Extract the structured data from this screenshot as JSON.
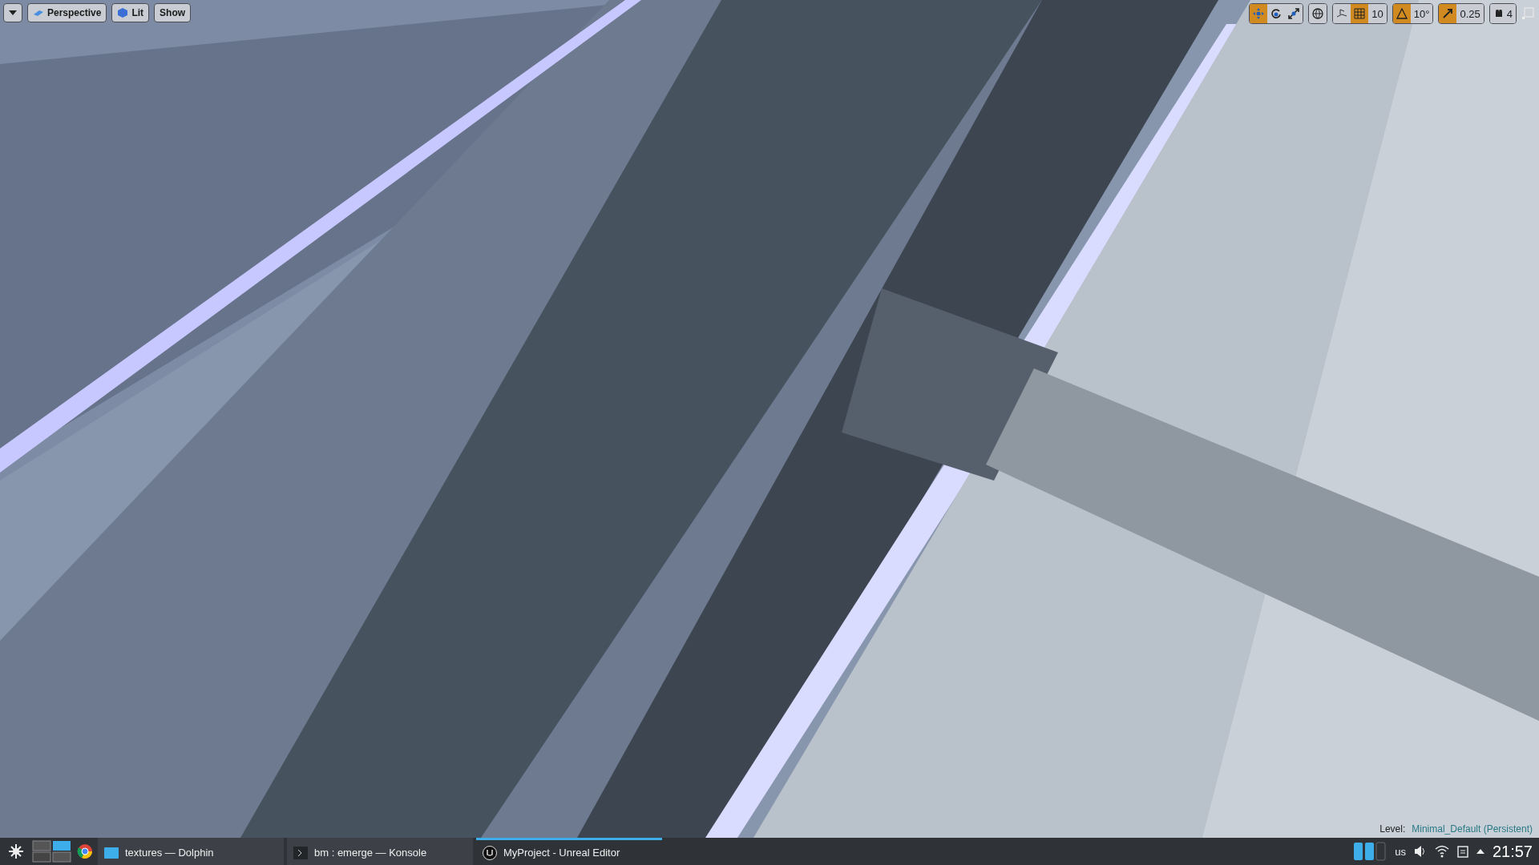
{
  "viewport_toolbar": {
    "left": [
      {
        "kind": "menu"
      },
      {
        "kind": "button",
        "label": "Perspective"
      },
      {
        "kind": "button",
        "label": "Lit"
      },
      {
        "kind": "button",
        "label": "Show"
      }
    ],
    "transform_tools": [
      {
        "kind": "translate",
        "selected": true
      },
      {
        "kind": "rotate",
        "selected": false
      },
      {
        "kind": "scale",
        "selected": false
      }
    ],
    "grid_snap": {
      "on": true,
      "value": "10"
    },
    "rotation_snap": {
      "on": true,
      "value": "10°"
    },
    "scale_snap": {
      "on": true,
      "value": "0.25"
    },
    "camera_speed": {
      "value": "4"
    }
  },
  "level": {
    "label": "Level:",
    "value": "Minimal_Default (Persistent)"
  },
  "taskbar": {
    "tasks": [
      {
        "label": "textures — Dolphin",
        "selected": false
      },
      {
        "label": "bm : emerge — Konsole",
        "selected": false
      },
      {
        "label": "MyProject - Unreal Editor",
        "selected": true
      }
    ],
    "keyboard_layout": "us",
    "clock": "21:57"
  }
}
